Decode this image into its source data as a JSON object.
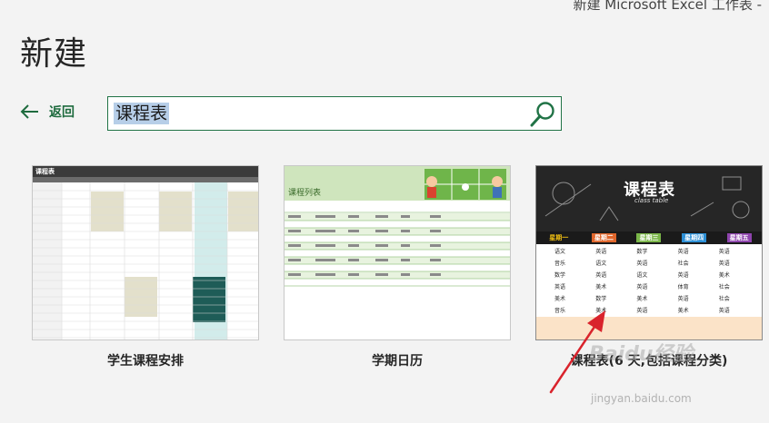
{
  "window": {
    "title": "新建 Microsoft Excel 工作表  -"
  },
  "page": {
    "title": "新建"
  },
  "nav": {
    "back_label": "返回"
  },
  "search": {
    "value": "课程表"
  },
  "templates": [
    {
      "label": "学生课程安排",
      "thumb_title": "课程表"
    },
    {
      "label": "学期日历",
      "thumb_title": "课程列表"
    },
    {
      "label": "课程表(6 天,包括课程分类)",
      "thumb_title": "课程表",
      "thumb_subtitle": "class table"
    }
  ],
  "thumb3_days": [
    "星期一",
    "星期二",
    "星期三",
    "星期四",
    "星期五"
  ],
  "thumb3_subjects": [
    "语文",
    "英语",
    "数学",
    "英语",
    "英语",
    "音乐",
    "语文",
    "英语",
    "社会",
    "英语",
    "数学",
    "英语",
    "语文",
    "英语",
    "美术",
    "英语",
    "美术",
    "英语",
    "体育",
    "社会",
    "美术",
    "数学",
    "美术",
    "英语",
    "社会",
    "音乐",
    "美术",
    "英语",
    "美术",
    "英语"
  ],
  "watermark": {
    "text": "Baidu经验",
    "url": "jingyan.baidu.com"
  },
  "colors": {
    "accent": "#217346",
    "search_highlight": "#b7cee8",
    "arrow": "#d9232c"
  }
}
